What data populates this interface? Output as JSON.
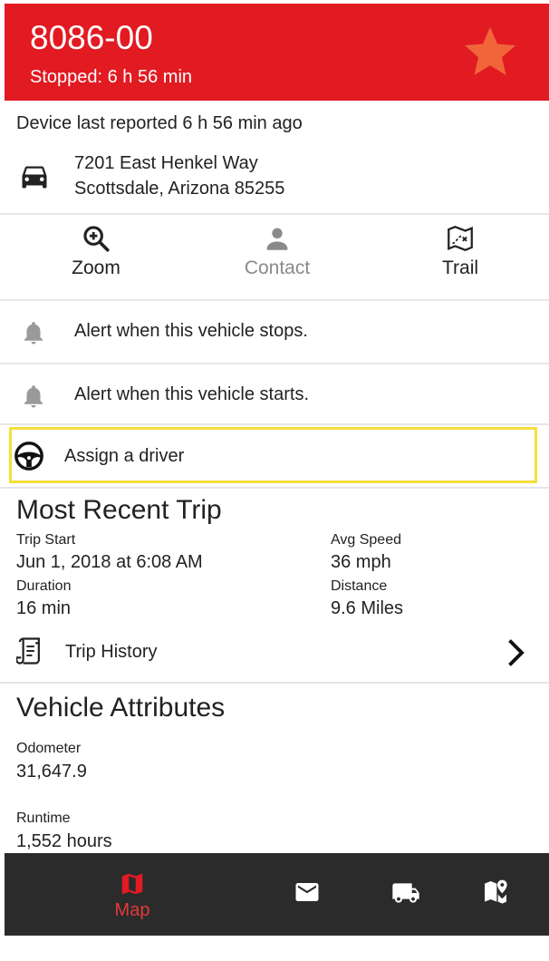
{
  "header": {
    "title": "8086-00",
    "subtitle": "Stopped: 6 h 56 min",
    "favorite_icon": "star-icon",
    "color": "#e21a22",
    "star_color": "#f0663a"
  },
  "device": {
    "reported": "Device last reported 6 h 56 min ago",
    "address_line1": "7201 East Henkel Way",
    "address_line2": "Scottsdale, Arizona 85255"
  },
  "actions": [
    {
      "label": "Zoom",
      "icon": "zoom-in-icon"
    },
    {
      "label": "Contact",
      "icon": "person-icon"
    },
    {
      "label": "Trail",
      "icon": "map-trail-icon"
    }
  ],
  "alerts": [
    {
      "label": "Alert when this vehicle stops."
    },
    {
      "label": "Alert when this vehicle starts."
    }
  ],
  "assign_driver": {
    "label": "Assign a driver",
    "highlight": "#f6df3c"
  },
  "recent_trip": {
    "title": "Most Recent Trip",
    "trip_start_label": "Trip Start",
    "trip_start_value": "Jun 1, 2018 at 6:08 AM",
    "avg_speed_label": "Avg Speed",
    "avg_speed_value": "36 mph",
    "duration_label": "Duration",
    "duration_value": "16 min",
    "distance_label": "Distance",
    "distance_value": "9.6 Miles",
    "history_label": "Trip History"
  },
  "attributes": {
    "title": "Vehicle Attributes",
    "odometer_label": "Odometer",
    "odometer_value": "31,647.9",
    "runtime_label": "Runtime",
    "runtime_value": "1,552 hours"
  },
  "bottom_nav": {
    "active_label": "Map",
    "items": [
      "map-icon",
      "mail-icon",
      "truck-icon",
      "map-pin-icon"
    ],
    "active_color": "#e53a3a"
  }
}
